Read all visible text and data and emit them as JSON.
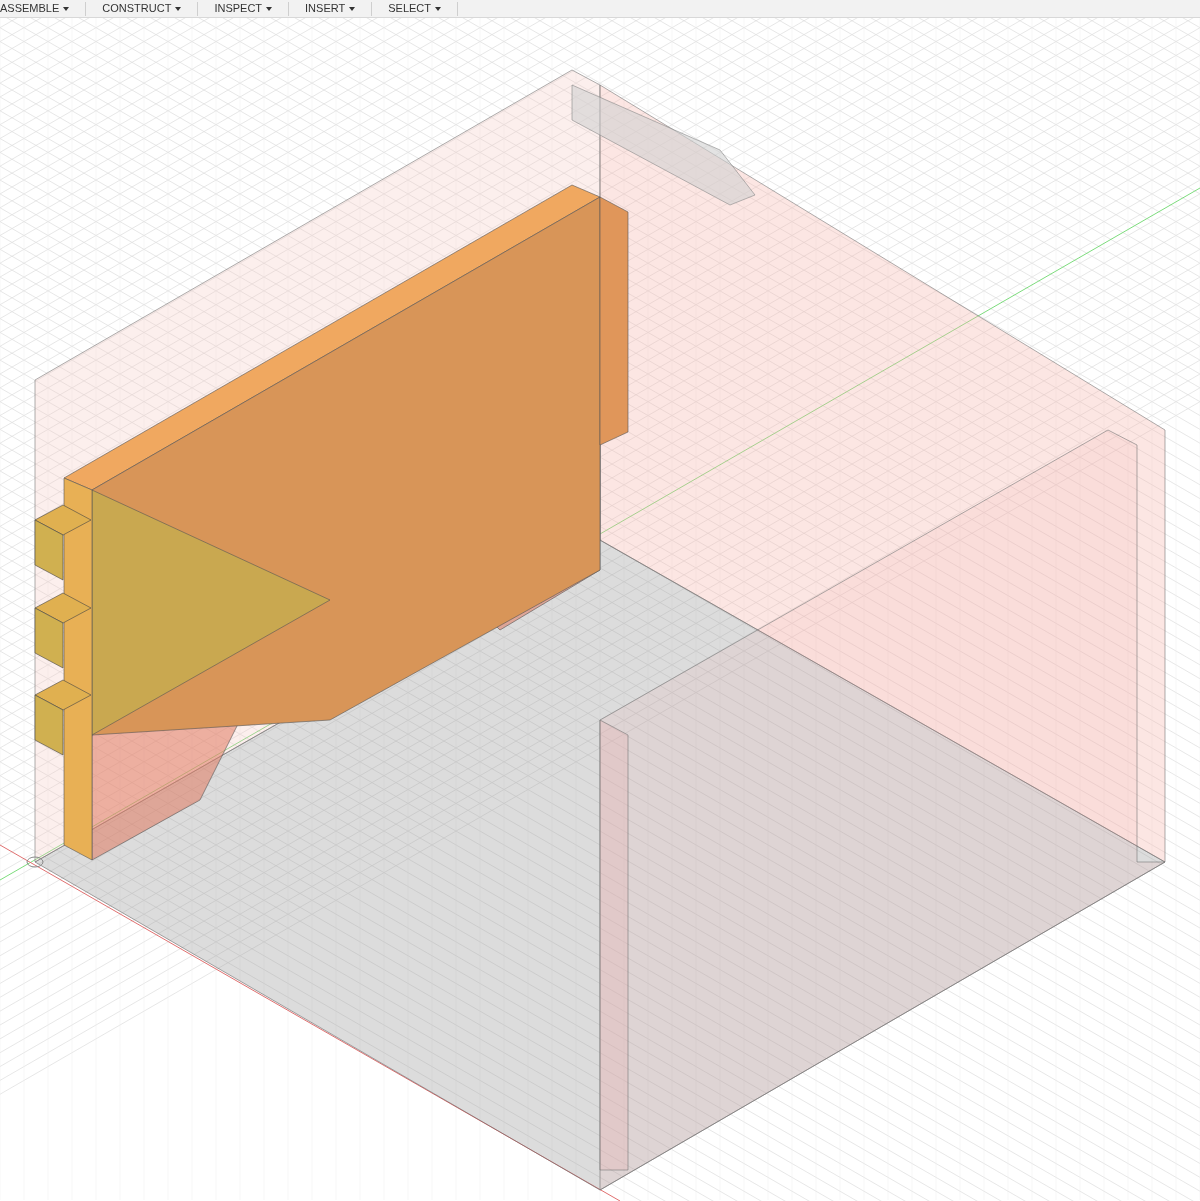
{
  "toolbar": {
    "menus": [
      {
        "label": "ASSEMBLE"
      },
      {
        "label": "CONSTRUCT"
      },
      {
        "label": "INSPECT"
      },
      {
        "label": "INSERT"
      },
      {
        "label": "SELECT"
      }
    ]
  }
}
